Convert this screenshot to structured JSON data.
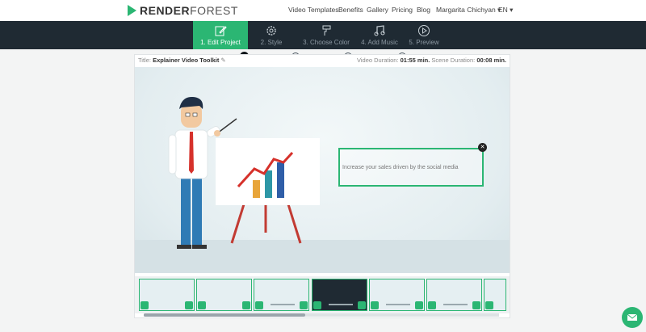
{
  "brand": {
    "bold": "RENDER",
    "light": "FOREST",
    "color": "#2bb673"
  },
  "nav": {
    "video_templates": "Video Templates",
    "benefits": "Benefits",
    "gallery": "Gallery",
    "pricing": "Pricing",
    "blog": "Blog",
    "user": "Margarita Chichyan ▾",
    "lang": "EN ▾"
  },
  "steps": {
    "edit": "1. Edit Project",
    "style": "2. Style",
    "color": "3. Choose Color",
    "music": "4. Add Music",
    "preview": "5. Preview"
  },
  "project": {
    "title_label": "Title:",
    "title": "Explainer Video Toolkit",
    "video_duration_label": "Video Duration:",
    "video_duration": "01:55 min.",
    "scene_duration_label": "Scene Duration:",
    "scene_duration": "00:08 min."
  },
  "scene": {
    "text_field": "Increase your sales driven by the social media"
  },
  "thumbs": {
    "t1": "",
    "t4": "Learn more here",
    "t5": "Type your text here",
    "t6": "Type your text here"
  }
}
